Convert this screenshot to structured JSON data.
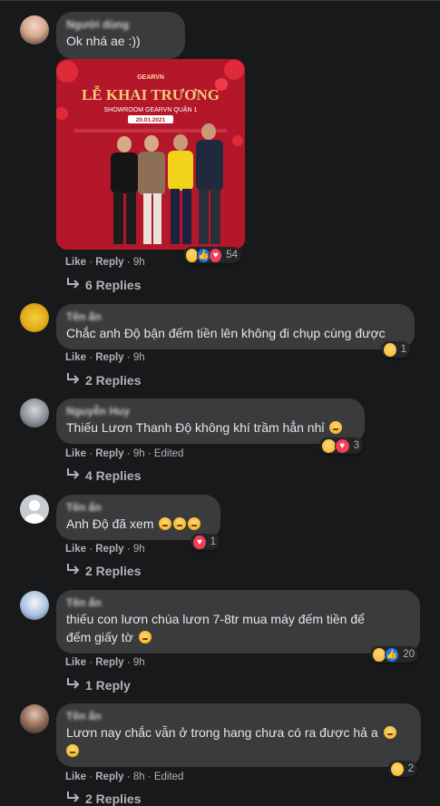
{
  "comments": [
    {
      "text": "Ok nhá ae :))",
      "like": "Like",
      "reply": "Reply",
      "time": "9h",
      "reactions_count": "54",
      "replies": "6 Replies",
      "photo": {
        "banner": "LỄ KHAI TRƯƠNG",
        "subtitle": "SHOWROOM GEARVN QUẬN 1",
        "date": "20.01.2021",
        "brand": "GEARVN"
      }
    },
    {
      "text": "Chắc anh Độ bận đếm tiền lên không đi chụp cùng được",
      "like": "Like",
      "reply": "Reply",
      "time": "9h",
      "reactions_count": "1",
      "replies": "2 Replies"
    },
    {
      "name": "Nguyễn Huy",
      "text": "Thiếu Lươn Thanh Độ không khí trầm hẳn nhỉ",
      "like": "Like",
      "reply": "Reply",
      "time": "9h",
      "edited": "Edited",
      "reactions_count": "3",
      "replies": "4 Replies"
    },
    {
      "text": "Anh Độ đã xem",
      "like": "Like",
      "reply": "Reply",
      "time": "9h",
      "reactions_count": "1",
      "replies": "2 Replies"
    },
    {
      "text_line1": "thiếu con lươn chúa lươn 7-8tr mua máy đếm tiền để",
      "text_line2": "đếm giấy tờ",
      "like": "Like",
      "reply": "Reply",
      "time": "9h",
      "reactions_count": "20",
      "replies": "1 Reply"
    },
    {
      "text_line1": "Lươn nay chắc vẫn ở trong hang chưa có ra được hả a",
      "like": "Like",
      "reply": "Reply",
      "time": "8h",
      "edited": "Edited",
      "reactions_count": "2",
      "replies": "2 Replies"
    }
  ],
  "colors": {
    "background": "#18191a",
    "bubble": "#3a3b3c",
    "text": "#e4e6eb",
    "secondary": "#b0b3b8",
    "like_blue": "#1877f2",
    "heart_red": "#f33e58",
    "haha_yellow": "#f7b125"
  }
}
